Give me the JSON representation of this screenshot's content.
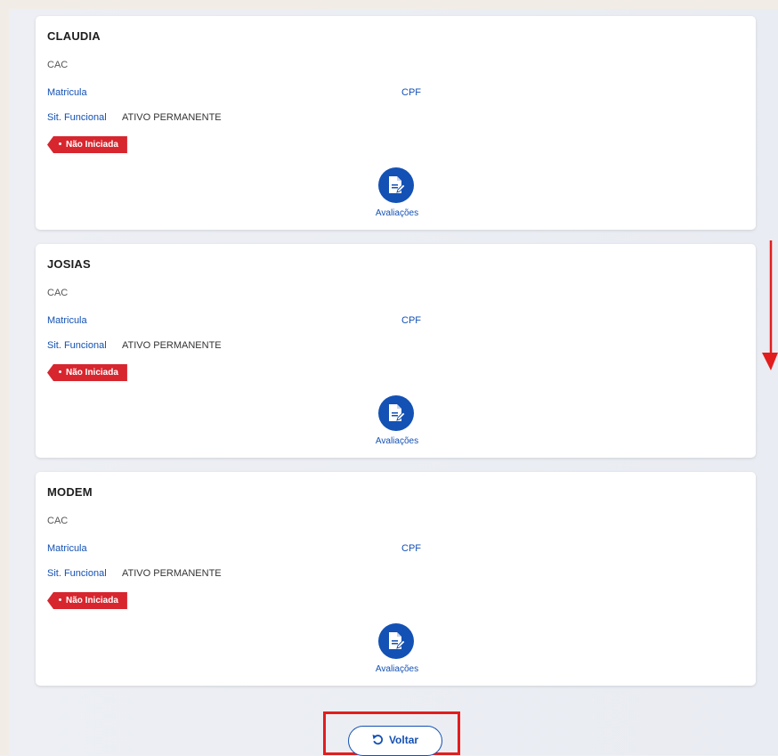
{
  "employees": [
    {
      "name": "CLAUDIA",
      "unit": "CAC",
      "matricula_label": "Matricula",
      "cpf_label": "CPF",
      "sit_label": "Sit. Funcional",
      "sit_value": "ATIVO PERMANENTE",
      "status": "Não Iniciada",
      "action_label": "Avaliações"
    },
    {
      "name": "JOSIAS",
      "unit": "CAC",
      "matricula_label": "Matricula",
      "cpf_label": "CPF",
      "sit_label": "Sit. Funcional",
      "sit_value": "ATIVO PERMANENTE",
      "status": "Não Iniciada",
      "action_label": "Avaliações"
    },
    {
      "name": "MODEM",
      "unit": "CAC",
      "matricula_label": "Matricula",
      "cpf_label": "CPF",
      "sit_label": "Sit. Funcional",
      "sit_value": "ATIVO PERMANENTE",
      "status": "Não Iniciada",
      "action_label": "Avaliações"
    }
  ],
  "footer": {
    "back_label": "Voltar"
  },
  "colors": {
    "primary": "#1351b4",
    "status_red": "#d7262e",
    "annotation_red": "#e21d1d"
  },
  "icons": {
    "action_icon": "document-edit-icon",
    "back_icon": "undo-icon"
  }
}
